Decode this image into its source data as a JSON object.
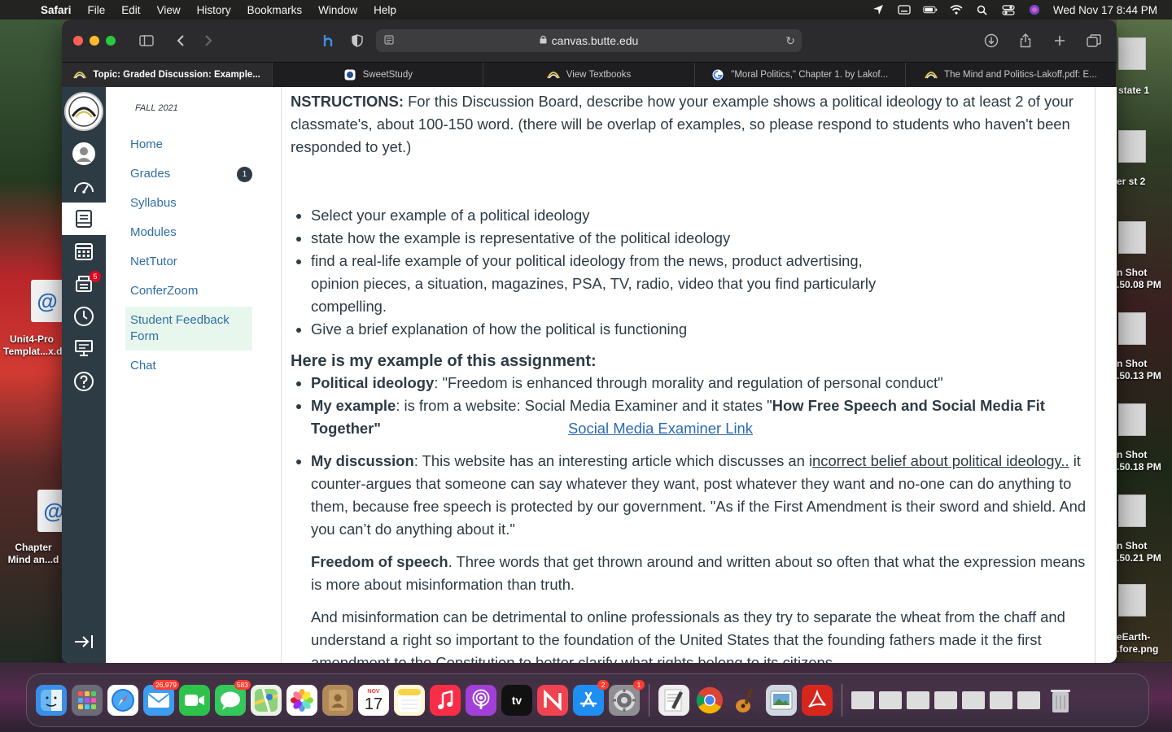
{
  "menubar": {
    "app": "Safari",
    "menus": [
      "File",
      "Edit",
      "View",
      "History",
      "Bookmarks",
      "Window",
      "Help"
    ],
    "clock": "Wed Nov 17  8:44 PM"
  },
  "desktop": {
    "left_icons": [
      {
        "label": "Unit4-Pro\nTemplat...x.d"
      },
      {
        "label": "Chapter\nMind an...d"
      }
    ],
    "right_labels": [
      "state 1",
      "er st 2",
      "n Shot\n.50.08 PM",
      "n Shot\n.50.13 PM",
      "n Shot\n.50.18 PM",
      "n Shot\n.50.21 PM",
      "eEarth-\n.fore.png"
    ]
  },
  "browser": {
    "url": "canvas.butte.edu",
    "tabs": [
      {
        "label": "Topic: Graded Discussion: Example...",
        "active": true
      },
      {
        "label": "SweetStudy",
        "active": false
      },
      {
        "label": "View Textbooks",
        "active": false
      },
      {
        "label": "\"Moral Politics,\" Chapter 1. by Lakof...",
        "active": false
      },
      {
        "label": "The Mind and Politics-Lakoff.pdf: E...",
        "active": false
      }
    ]
  },
  "canvas": {
    "global_nav": {
      "inbox_badge": "5"
    },
    "term": "FALL 2021",
    "course_nav": [
      {
        "label": "Home"
      },
      {
        "label": "Grades",
        "count": "1"
      },
      {
        "label": "Syllabus"
      },
      {
        "label": "Modules"
      },
      {
        "label": "NetTutor"
      },
      {
        "label": "ConferZoom"
      },
      {
        "label": "Student Feedback Form"
      },
      {
        "label": "Chat"
      }
    ],
    "discussion": {
      "instr_label": "NSTRUCTIONS:",
      "instr_text": " For this Discussion Board, describe how your example shows a political ideology to at least 2 of your classmate's, about 100-150 word.   (there will be overlap of examples, so please respond to  students who haven't been responded to yet.)",
      "bullets": [
        "Select your example of a political ideology",
        "state how the example is representative of the political ideology",
        "find a real-life example of your political ideology from the news, product advertising, opinion pieces, a situation, magazines, PSA, TV, radio, video that you find particularly compelling.",
        "Give a brief explanation of how the political is functioning"
      ],
      "example_heading": "Here is my example of this assignment:",
      "ideology_label": "Political ideology",
      "ideology_text": ": \"Freedom is enhanced through morality and regulation of personal conduct\"",
      "example_label": "My example",
      "example_text": ": is from a website: Social Media Examiner and it states \"",
      "example_quote": "How Free Speech and Social Media Fit Together\"",
      "link_text": "Social Media Examiner Link",
      "discussion_label": "My discussion",
      "discussion_text_a": ": This website has an interesting article which discusses an i",
      "discussion_underlined": "ncorrect belief about political ideology..",
      "discussion_text_b": " it counter-argues that someone can say whatever they want, post whatever they want and no-one can do anything to them, because free speech is protected by our government.  \"As if the First Amendment is their sword and shield. And you can’t do anything about it.\"",
      "freedom_label": "Freedom of speech",
      "freedom_text": ". Three words that get thrown around and written about so often that what the expression means is more about misinformation than truth.",
      "misinfo_text": "And misinformation can be detrimental to online professionals as they try to separate the wheat from the chaff and understand a right so important to the foundation of the United States that the founding fathers made it the first amendment to the Constitution to better clarify what rights belong to its citizens."
    }
  },
  "dock": {
    "apps": [
      {
        "name": "finder",
        "color": "#3a8ee6"
      },
      {
        "name": "launchpad",
        "color": "#7a7a8a"
      },
      {
        "name": "safari",
        "color": "#2a7de1"
      },
      {
        "name": "mail",
        "color": "#3c9cf0",
        "badge": "26,979"
      },
      {
        "name": "facetime",
        "color": "#2fc24b"
      },
      {
        "name": "messages",
        "color": "#34c759",
        "badge": "583"
      },
      {
        "name": "maps",
        "color": "#59b85c"
      },
      {
        "name": "photos",
        "color": "#f2f2f2"
      },
      {
        "name": "contacts",
        "color": "#b08a5a"
      },
      {
        "name": "calendar",
        "color": "#ffffff",
        "month": "NOV",
        "day": "17"
      },
      {
        "name": "notes",
        "color": "#f7d348"
      },
      {
        "name": "music",
        "color": "#fa2d48"
      },
      {
        "name": "podcasts",
        "color": "#a23fd8"
      },
      {
        "name": "tv",
        "color": "#111111",
        "label": "tv"
      },
      {
        "name": "news",
        "color": "#f04352"
      },
      {
        "name": "appstore",
        "color": "#1f8ef1",
        "badge": "2"
      },
      {
        "name": "system-preferences",
        "color": "#8e8e93",
        "badge": "1"
      },
      {
        "name": "textedit",
        "color": "#eeeeee"
      },
      {
        "name": "chrome",
        "color": "#ffffff"
      },
      {
        "name": "garageband",
        "color": "#d98a2b"
      },
      {
        "name": "preview",
        "color": "#cfd8e0"
      },
      {
        "name": "acrobat",
        "color": "#d7261e"
      }
    ]
  }
}
